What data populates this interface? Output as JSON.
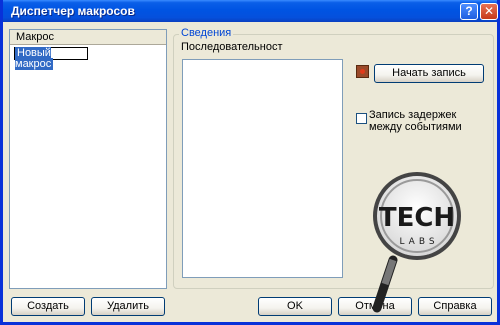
{
  "window": {
    "title": "Диспетчер макросов",
    "help_glyph": "?",
    "close_glyph": "✕"
  },
  "left_panel": {
    "header": "Макрос",
    "items": [
      {
        "label": "Новый макрос"
      }
    ]
  },
  "group": {
    "legend": "Сведения",
    "sequence_label": "Последовательност",
    "start_record_label": "Начать запись",
    "delay_checkbox_label": "Запись задержек между событиями",
    "delay_checked": false
  },
  "buttons": {
    "create": "Создать",
    "delete": "Удалить",
    "ok": "OK",
    "cancel": "Отмена",
    "help": "Справка"
  },
  "watermark": {
    "text_top": "TECH",
    "text_bottom": "LABS"
  },
  "colors": {
    "title_bar": "#0054e3",
    "legend": "#0046d5",
    "selection": "#316ac5",
    "record": "#e23a1a"
  }
}
